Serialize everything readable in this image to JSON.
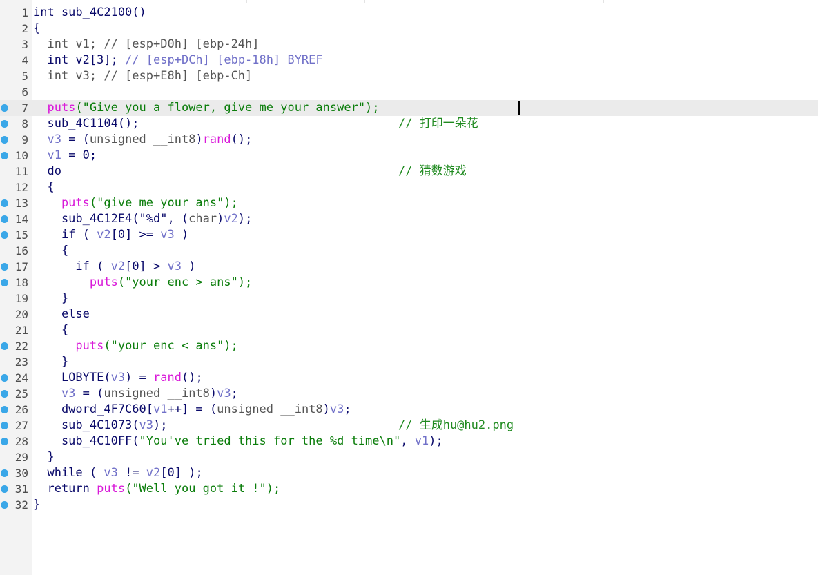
{
  "editor": {
    "caret_line": 7,
    "colors": {
      "keyword": "#0a0a6a",
      "variable": "#7070c8",
      "string": "#0b7d0b",
      "library_function": "#d91ad9",
      "comment": "#1f8a1f",
      "breakpoint": "#3aa7e8",
      "gutter": "#f3f3f3",
      "current_line": "#ebebeb"
    },
    "lines": [
      {
        "n": "1",
        "bp": false,
        "tokens": [
          [
            "kw",
            "int sub_4C2100()"
          ]
        ]
      },
      {
        "n": "2",
        "bp": false,
        "tokens": [
          [
            "punc",
            "{"
          ]
        ]
      },
      {
        "n": "3",
        "bp": false,
        "tokens": [
          [
            "tp",
            "  int v1; // [esp+D0h] [ebp-24h]"
          ]
        ]
      },
      {
        "n": "4",
        "bp": false,
        "tokens": [
          [
            "kw",
            "  int v2[3]; "
          ],
          [
            "var",
            "// [esp+DCh] [ebp-18h] BYREF"
          ]
        ]
      },
      {
        "n": "5",
        "bp": false,
        "tokens": [
          [
            "tp",
            "  int v3; // [esp+E8h] [ebp-Ch]"
          ]
        ]
      },
      {
        "n": "6",
        "bp": false,
        "tokens": []
      },
      {
        "n": "7",
        "bp": true,
        "tokens": [
          [
            "lib",
            "  puts"
          ],
          [
            "str",
            "(\"Give you a flower, give me your answer\");"
          ]
        ]
      },
      {
        "n": "8",
        "bp": true,
        "tokens": [
          [
            "kw",
            "  sub_4C1104();"
          ]
        ],
        "comment": "// 打印一朵花"
      },
      {
        "n": "9",
        "bp": true,
        "tokens": [
          [
            "var",
            "  v3"
          ],
          [
            "kw",
            " = ("
          ],
          [
            "tp",
            "unsigned __int8"
          ],
          [
            "kw",
            ")"
          ],
          [
            "lib",
            "rand"
          ],
          [
            "kw",
            "();"
          ]
        ]
      },
      {
        "n": "10",
        "bp": true,
        "tokens": [
          [
            "var",
            "  v1"
          ],
          [
            "kw",
            " = 0;"
          ]
        ]
      },
      {
        "n": "11",
        "bp": false,
        "tokens": [
          [
            "kw",
            "  do"
          ]
        ],
        "comment": "// 猜数游戏"
      },
      {
        "n": "12",
        "bp": false,
        "tokens": [
          [
            "kw",
            "  {"
          ]
        ]
      },
      {
        "n": "13",
        "bp": true,
        "tokens": [
          [
            "lib",
            "    puts"
          ],
          [
            "str",
            "(\"give me your ans\");"
          ]
        ]
      },
      {
        "n": "14",
        "bp": true,
        "tokens": [
          [
            "kw",
            "    sub_4C12E4(\"%d\", ("
          ],
          [
            "tp",
            "char"
          ],
          [
            "kw",
            ")"
          ],
          [
            "var",
            "v2"
          ],
          [
            "kw",
            ");"
          ]
        ]
      },
      {
        "n": "15",
        "bp": true,
        "tokens": [
          [
            "kw",
            "    if ( "
          ],
          [
            "var",
            "v2"
          ],
          [
            "kw",
            "[0] >= "
          ],
          [
            "var",
            "v3"
          ],
          [
            "kw",
            " )"
          ]
        ]
      },
      {
        "n": "16",
        "bp": false,
        "tokens": [
          [
            "kw",
            "    {"
          ]
        ]
      },
      {
        "n": "17",
        "bp": true,
        "tokens": [
          [
            "kw",
            "      if ( "
          ],
          [
            "var",
            "v2"
          ],
          [
            "kw",
            "[0] > "
          ],
          [
            "var",
            "v3"
          ],
          [
            "kw",
            " )"
          ]
        ]
      },
      {
        "n": "18",
        "bp": true,
        "tokens": [
          [
            "lib",
            "        puts"
          ],
          [
            "str",
            "(\"your enc > ans\");"
          ]
        ]
      },
      {
        "n": "19",
        "bp": false,
        "tokens": [
          [
            "kw",
            "    }"
          ]
        ]
      },
      {
        "n": "20",
        "bp": false,
        "tokens": [
          [
            "kw",
            "    else"
          ]
        ]
      },
      {
        "n": "21",
        "bp": false,
        "tokens": [
          [
            "kw",
            "    {"
          ]
        ]
      },
      {
        "n": "22",
        "bp": true,
        "tokens": [
          [
            "lib",
            "      puts"
          ],
          [
            "str",
            "(\"your enc < ans\");"
          ]
        ]
      },
      {
        "n": "23",
        "bp": false,
        "tokens": [
          [
            "kw",
            "    }"
          ]
        ]
      },
      {
        "n": "24",
        "bp": true,
        "tokens": [
          [
            "kw",
            "    LOBYTE("
          ],
          [
            "var",
            "v3"
          ],
          [
            "kw",
            ") = "
          ],
          [
            "lib",
            "rand"
          ],
          [
            "kw",
            "();"
          ]
        ]
      },
      {
        "n": "25",
        "bp": true,
        "tokens": [
          [
            "var",
            "    v3"
          ],
          [
            "kw",
            " = ("
          ],
          [
            "tp",
            "unsigned __int8"
          ],
          [
            "kw",
            ")"
          ],
          [
            "var",
            "v3"
          ],
          [
            "kw",
            ";"
          ]
        ]
      },
      {
        "n": "26",
        "bp": true,
        "tokens": [
          [
            "kw",
            "    dword_4F7C60["
          ],
          [
            "var",
            "v1"
          ],
          [
            "kw",
            "++] = ("
          ],
          [
            "tp",
            "unsigned __int8"
          ],
          [
            "kw",
            ")"
          ],
          [
            "var",
            "v3"
          ],
          [
            "kw",
            ";"
          ]
        ]
      },
      {
        "n": "27",
        "bp": true,
        "tokens": [
          [
            "kw",
            "    sub_4C1073("
          ],
          [
            "var",
            "v3"
          ],
          [
            "kw",
            ");"
          ]
        ],
        "comment": "// 生成hu@hu2.png"
      },
      {
        "n": "28",
        "bp": true,
        "tokens": [
          [
            "kw",
            "    sub_4C10FF("
          ],
          [
            "str",
            "\"You've tried this for the %d time\\n\""
          ],
          [
            "kw",
            ", "
          ],
          [
            "var",
            "v1"
          ],
          [
            "kw",
            ");"
          ]
        ]
      },
      {
        "n": "29",
        "bp": false,
        "tokens": [
          [
            "kw",
            "  }"
          ]
        ]
      },
      {
        "n": "30",
        "bp": true,
        "tokens": [
          [
            "kw",
            "  while ( "
          ],
          [
            "var",
            "v3"
          ],
          [
            "kw",
            " != "
          ],
          [
            "var",
            "v2"
          ],
          [
            "kw",
            "[0] );"
          ]
        ]
      },
      {
        "n": "31",
        "bp": true,
        "tokens": [
          [
            "kw",
            "  return "
          ],
          [
            "lib",
            "puts"
          ],
          [
            "str",
            "(\"Well you got it !\");"
          ]
        ]
      },
      {
        "n": "32",
        "bp": true,
        "tokens": [
          [
            "punc",
            "}"
          ]
        ]
      }
    ]
  }
}
